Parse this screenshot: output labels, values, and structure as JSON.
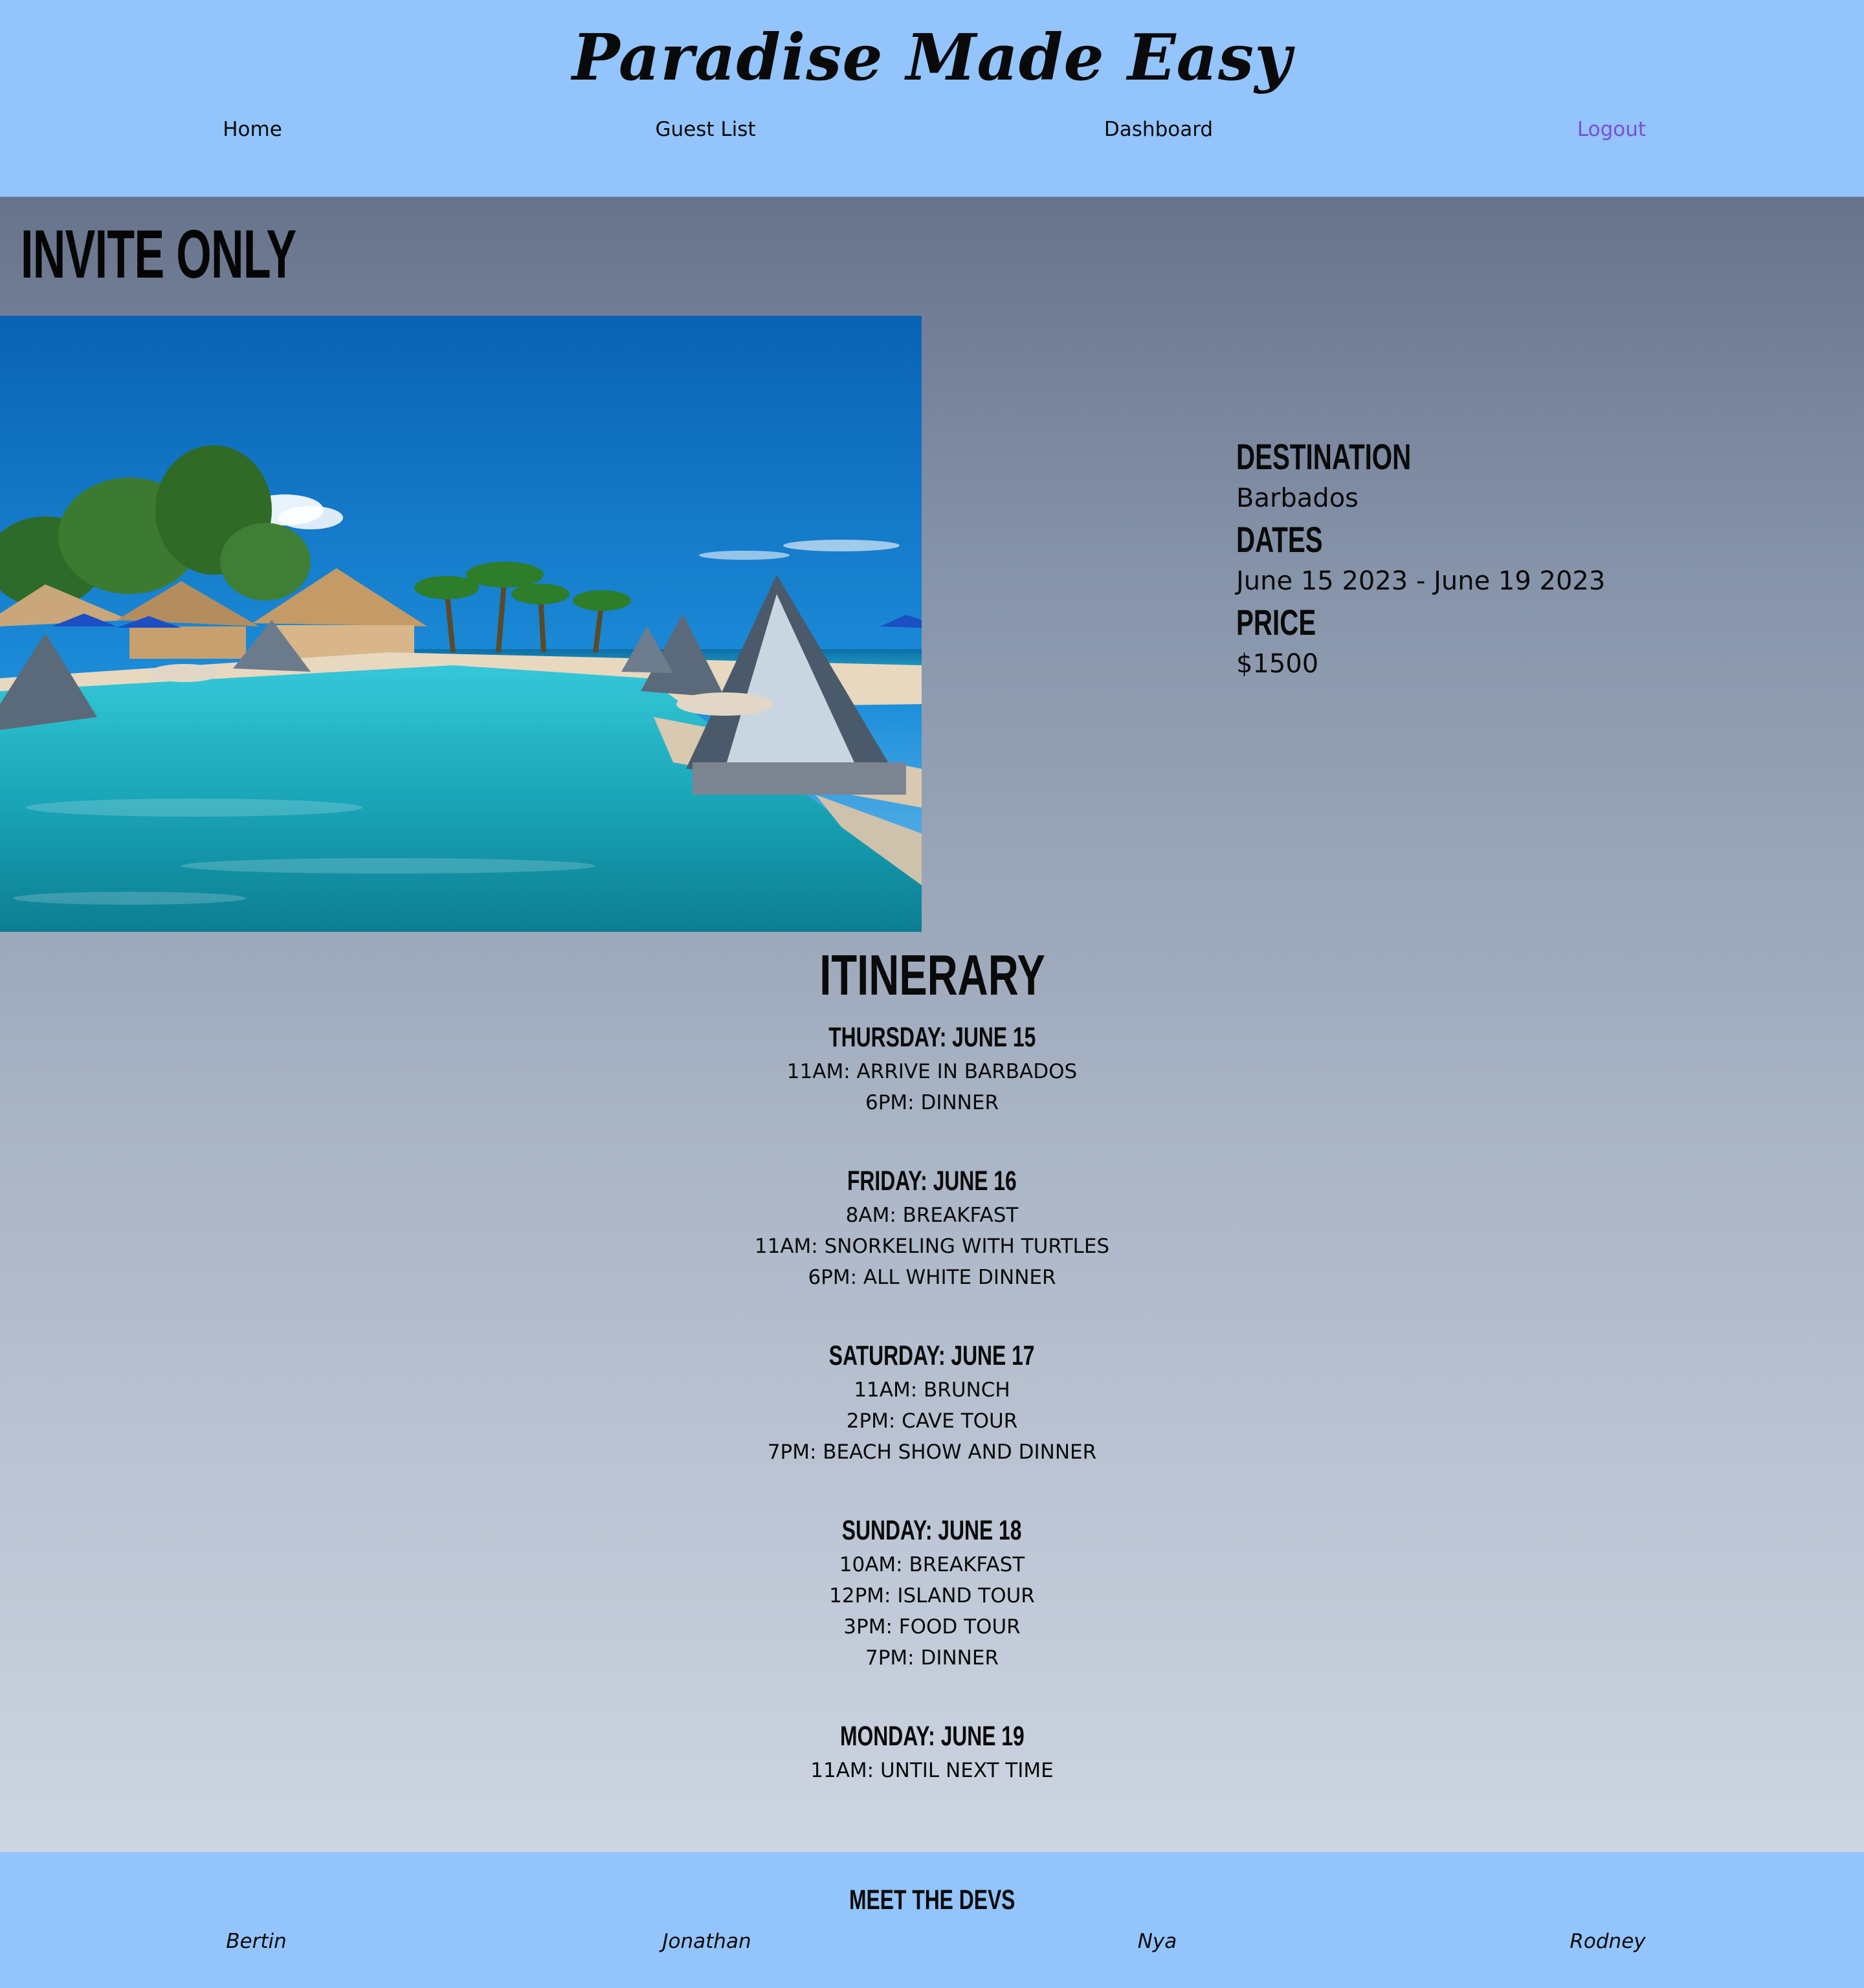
{
  "header": {
    "title": "Paradise Made Easy",
    "nav": {
      "home": "Home",
      "guest_list": "Guest List",
      "dashboard": "Dashboard",
      "logout": "Logout"
    }
  },
  "main": {
    "heading": "INVITE ONLY",
    "details": {
      "destination_label": "DESTINATION",
      "destination_value": "Barbados",
      "dates_label": "DATES",
      "dates_value": "June 15 2023 - June 19 2023",
      "price_label": "PRICE",
      "price_value": "$1500"
    },
    "itinerary": {
      "title": "ITINERARY",
      "days": [
        {
          "title": "THURSDAY: JUNE 15",
          "events": [
            "11AM: ARRIVE IN BARBADOS",
            "6PM: DINNER"
          ]
        },
        {
          "title": "FRIDAY: JUNE 16",
          "events": [
            "8AM: BREAKFAST",
            "11AM: SNORKELING WITH TURTLES",
            "6PM: ALL WHITE DINNER"
          ]
        },
        {
          "title": "SATURDAY: JUNE 17",
          "events": [
            "11AM: BRUNCH",
            "2PM: CAVE TOUR",
            "7PM: BEACH SHOW AND DINNER"
          ]
        },
        {
          "title": "SUNDAY: JUNE 18",
          "events": [
            "10AM: BREAKFAST",
            "12PM: ISLAND TOUR",
            "3PM: FOOD TOUR",
            "7PM: DINNER"
          ]
        },
        {
          "title": "MONDAY: JUNE 19",
          "events": [
            "11AM: UNTIL NEXT TIME"
          ]
        }
      ]
    }
  },
  "footer": {
    "title": "MEET THE DEVS",
    "devs": [
      "Bertin",
      "Jonathan",
      "Nya",
      "Rodney"
    ]
  },
  "colors": {
    "header_bg": "#93c4fc",
    "logout_link": "#7a4fd0",
    "main_gradient_top": "#67738b",
    "main_gradient_bottom": "#cdd5e1"
  }
}
